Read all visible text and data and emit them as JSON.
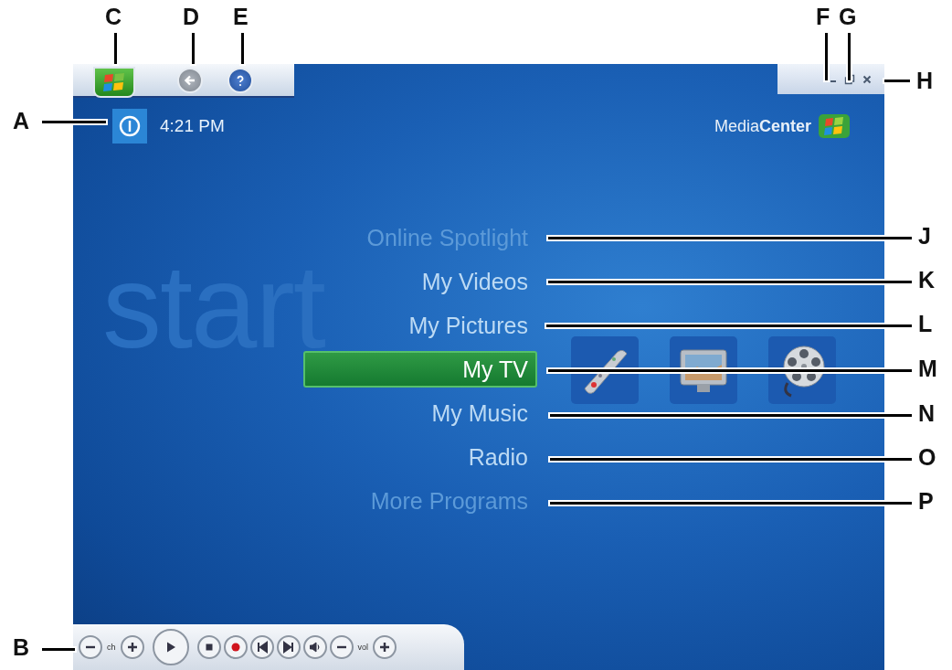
{
  "callouts": [
    {
      "letter": "A"
    },
    {
      "letter": "B"
    },
    {
      "letter": "C"
    },
    {
      "letter": "D"
    },
    {
      "letter": "E"
    },
    {
      "letter": "F"
    },
    {
      "letter": "G"
    },
    {
      "letter": "H"
    },
    {
      "letter": "J"
    },
    {
      "letter": "K"
    },
    {
      "letter": "L"
    },
    {
      "letter": "M"
    },
    {
      "letter": "N"
    },
    {
      "letter": "O"
    },
    {
      "letter": "P"
    }
  ],
  "screen": {
    "background_title": "start",
    "clock": "4:21 PM",
    "logo": "Media**Center**",
    "menu": [
      {
        "label": "Online Spotlight",
        "selected": false,
        "faded": true
      },
      {
        "label": "My Videos",
        "selected": false,
        "faded": false
      },
      {
        "label": "My Pictures",
        "selected": false,
        "faded": false
      },
      {
        "label": "My TV",
        "selected": true,
        "faded": false
      },
      {
        "label": "My Music",
        "selected": false,
        "faded": false
      },
      {
        "label": "Radio",
        "selected": false,
        "faded": false
      },
      {
        "label": "More Programs",
        "selected": false,
        "faded": true
      }
    ],
    "thumbnails": [
      {
        "kind": "remote"
      },
      {
        "kind": "monitor"
      },
      {
        "kind": "reel"
      }
    ],
    "transport": [
      {
        "kind": "minus"
      },
      {
        "kind": "label",
        "text": "ch"
      },
      {
        "kind": "plus"
      },
      {
        "kind": "play"
      },
      {
        "kind": "stop"
      },
      {
        "kind": "record"
      },
      {
        "kind": "prev"
      },
      {
        "kind": "next"
      },
      {
        "kind": "mute"
      },
      {
        "kind": "minus"
      },
      {
        "kind": "label",
        "text": "vol"
      },
      {
        "kind": "plus"
      }
    ]
  }
}
